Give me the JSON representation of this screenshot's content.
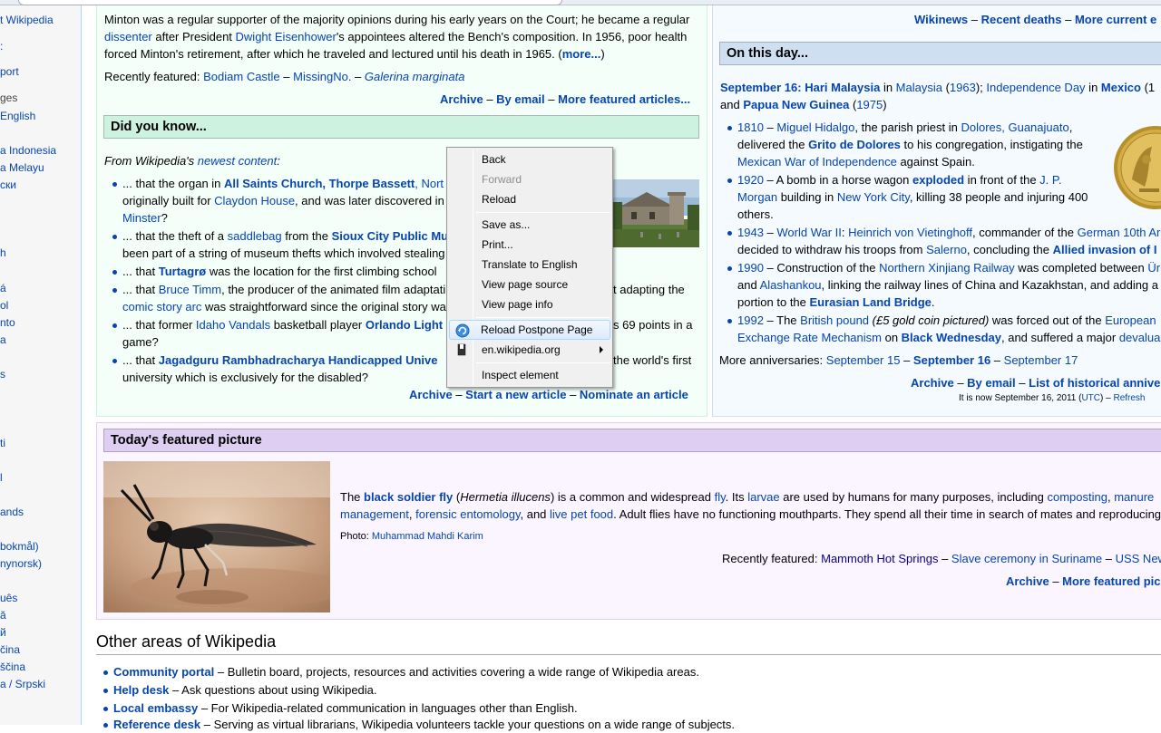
{
  "sidebar": {
    "items": [
      {
        "label": "t Wikipedia",
        "link": true
      },
      {
        "label": ":",
        "link": true
      },
      {
        "label": "port",
        "link": true
      },
      {
        "label": "ges",
        "link": false
      },
      {
        "label": " English",
        "link": true
      },
      {
        "label": "a Indonesia",
        "link": true
      },
      {
        "label": "a Melayu",
        "link": true
      },
      {
        "label": "ски",
        "link": true
      },
      {
        "label": "h",
        "link": true
      },
      {
        "label": "á",
        "link": true
      },
      {
        "label": "ol",
        "link": true
      },
      {
        "label": "nto",
        "link": true
      },
      {
        "label": "a",
        "link": true
      },
      {
        "label": "s",
        "link": true
      },
      {
        "label": "ti",
        "link": true
      },
      {
        "label": "l",
        "link": true
      },
      {
        "label": "ands",
        "link": true
      },
      {
        "label": "bokmål)",
        "link": true
      },
      {
        "label": "nynorsk)",
        "link": true
      },
      {
        "label": "uês",
        "link": true
      },
      {
        "label": "ă",
        "link": true
      },
      {
        "label": "й",
        "link": true
      },
      {
        "label": "čina",
        "link": true
      },
      {
        "label": "ščina",
        "link": true
      },
      {
        "label": "a / Srpski",
        "link": true
      }
    ]
  },
  "tfa": {
    "l1_a": "Minton was a regular supporter of the majority opinions during his early years on the Court; he became a regular",
    "l2_link1": "dissenter",
    "l2_a": " after President ",
    "l2_link2": "Dwight Eisenhower",
    "l2_b": "'s appointees altered the Bench's composition. In 1956, poor health",
    "l3_a": "forced Minton's retirement, after which he traveled and lectured until his death in 1965. (",
    "l3_more": "more...",
    "l3_b": ")",
    "recent_label": "Recently featured: ",
    "recent_1": "Bodiam Castle",
    "recent_sep1": " – ",
    "recent_2": "MissingNo.",
    "recent_sep2": " – ",
    "recent_3": "Galerina marginata",
    "archive": "Archive",
    "sep": " – ",
    "by_email": "By email",
    "more_articles": "More featured articles..."
  },
  "dyk": {
    "heading": "Did you know...",
    "intro_a": "From Wikipedia's ",
    "intro_link": "newest content",
    "intro_b": ":",
    "b1_a": "... that the organ in ",
    "b1_link": "All Saints Church, Thorpe Bassett",
    "b1_b": ", Nort",
    "b1_l2_a": "originally built for ",
    "b1_l2_link": "Claydon House",
    "b1_l2_b": ", and was later discovered in ",
    "b1_l3": "Minster",
    "b1_l3_b": "?",
    "b2_a": "... that the theft of a ",
    "b2_link1": "saddlebag",
    "b2_b": " from the ",
    "b2_link2": "Sioux City Public Mu",
    "b2_l2": "been part of a string of museum thefts which involved stealing",
    "b3_a": "... that ",
    "b3_link": "Turtagrø",
    "b3_b": " was the location for the first climbing school",
    "b4_a": "... that ",
    "b4_link": "Bruce Timm",
    "b4_b": ", the producer of the animated film adaptati",
    "b4_c": "t adapting the",
    "b4_l2_link": "comic story arc",
    "b4_l2": " was straightforward since the original story wa",
    "b5_a": "... that former ",
    "b5_link1": "Idaho Vandals",
    "b5_b": " basketball player ",
    "b5_link2": "Orlando Light",
    "b5_c": "s 69 points in a",
    "b5_l2": "game?",
    "b6_a": "... that ",
    "b6_link": "Jagadguru Rambhadracharya Handicapped Unive",
    "b6_b": " the world's first",
    "b6_l2": "university which is exclusively for the disabled?",
    "archive": "Archive",
    "sep": " – ",
    "start": "Start a new article",
    "nominate": "Nominate an article"
  },
  "news": {
    "top_1": "Wikinews",
    "top_sep1": " – ",
    "top_2": "Recent deaths",
    "top_sep2": " – ",
    "top_3": "More current e"
  },
  "otd": {
    "heading": "On this day...",
    "l1_date": "September 16",
    "l1_colon": ": ",
    "l1_link1": "Hari Malaysia",
    "l1_in": " in ",
    "l1_link2": "Malaysia",
    "l1_paren_o": " (",
    "l1_year": "1963",
    "l1_paren_c": "); ",
    "l1_link3": "Independence Day",
    "l1_in2": " in ",
    "l1_link4": "Mexico",
    "l1_tail": " (1",
    "l2_a": "and ",
    "l2_link": "Papua New Guinea",
    "l2_b": " (",
    "l2_year": "1975",
    "l2_c": ")",
    "e1_year": "1810",
    "e1_a": " – ",
    "e1_link1": "Miguel Hidalgo",
    "e1_b": ", the parish priest in ",
    "e1_link2": "Dolores, Guanajuato",
    "e1_c": ",",
    "e1_l2_a": "delivered the ",
    "e1_l2_link": "Grito de Dolores",
    "e1_l2_b": " to his congregation, instigating the",
    "e1_l3_link": "Mexican War of Independence",
    "e1_l3_b": " against Spain.",
    "e2_year": "1920",
    "e2_a": " – A bomb in a horse wagon ",
    "e2_link1": "exploded",
    "e2_b": " in front of the ",
    "e2_link2": "J. P.",
    "e2_l2_link": "Morgan",
    "e2_l2_a": " building in ",
    "e2_l2_link2": "New York City",
    "e2_l2_b": ", killing 38 people and injuring 400",
    "e2_l3": "others.",
    "e3_year": "1943",
    "e3_a": " – ",
    "e3_link1": "World War II",
    "e3_b": ": ",
    "e3_link2": "Heinrich von Vietinghoff",
    "e3_c": ", commander of the ",
    "e3_link3": "German 10th Ar",
    "e3_l2_a": "decided to withdraw his troops from ",
    "e3_l2_link": "Salerno",
    "e3_l2_b": ", concluding the ",
    "e3_l2_link2": "Allied invasion of I",
    "e4_year": "1990",
    "e4_a": " – Construction of the ",
    "e4_link": "Northern Xinjiang Railway",
    "e4_b": " was completed between ",
    "e4_link2": "Ürü",
    "e4_l2_a": "and ",
    "e4_l2_link": "Alashankou",
    "e4_l2_b": ", linking the railway lines of China and Kazakhstan, and adding a",
    "e4_l3_a": "portion to the ",
    "e4_l3_link": "Eurasian Land Bridge",
    "e4_l3_b": ".",
    "e5_year": "1992",
    "e5_a": " – The ",
    "e5_link": "British pound",
    "e5_b": " (£5 gold coin pictured)",
    "e5_c": " was forced out of the ",
    "e5_link2": "European",
    "e5_l2_link": "Exchange Rate Mechanism",
    "e5_l2_a": " on ",
    "e5_l2_link2": "Black Wednesday",
    "e5_l2_b": ", and suffered a major ",
    "e5_l2_link3": "devalua",
    "more_label": "More anniversaries: ",
    "more_1": "September 15",
    "more_sep1": " – ",
    "more_2": "September 16",
    "more_sep2": " – ",
    "more_3": "September 17",
    "archive": "Archive",
    "sep": " – ",
    "by_email": "By email",
    "list": "List of historical annive",
    "now_a": "It is now September 16, 2011 (",
    "now_utc": "UTC",
    "now_b": ") – ",
    "now_refresh": "Refresh"
  },
  "tfp": {
    "heading": "Today's featured picture",
    "l1_a": "The ",
    "l1_link1": "black soldier fly",
    "l1_b": " (",
    "l1_i": "Hermetia illucens",
    "l1_c": ") is a common and widespread ",
    "l1_link2": "fly",
    "l1_d": ". Its ",
    "l1_link3": "larvae",
    "l1_e": " are used by humans for many purposes, including ",
    "l1_link4": "composting",
    "l1_f": ", ",
    "l1_link5": "manure",
    "l2_link1": "management",
    "l2_a": ", ",
    "l2_link2": "forensic entomology",
    "l2_b": ", and ",
    "l2_link3": "live pet food",
    "l2_c": ". Adult flies have no functioning mouthparts. They spend all their time in search of mates and reproducing",
    "photo_label": "Photo: ",
    "photo_link": "Muhammad Mahdi Karim",
    "recent_label": "Recently featured: ",
    "recent_1": "Mammoth Hot Springs",
    "recent_sep1": " – ",
    "recent_2": "Slave ceremony in Suriname",
    "recent_sep2": " – ",
    "recent_3": "USS New",
    "archive": "Archive",
    "sep": " – ",
    "more": "More featured pic"
  },
  "other": {
    "heading": "Other areas of Wikipedia",
    "i1_link": "Community portal",
    "i1_text": " – Bulletin board, projects, resources and activities covering a wide range of Wikipedia areas.",
    "i2_link": "Help desk",
    "i2_text": " – Ask questions about using Wikipedia.",
    "i3_link": "Local embassy",
    "i3_text": " – For Wikipedia-related communication in languages other than English.",
    "i4_link": "Reference desk",
    "i4_text": " – Serving as virtual librarians, Wikipedia volunteers tackle your questions on a wide range of subjects."
  },
  "context_menu": {
    "back": "Back",
    "forward": "Forward",
    "reload": "Reload",
    "save_as": "Save as...",
    "print": "Print...",
    "translate": "Translate to English",
    "view_source": "View page source",
    "view_info": "View page info",
    "reload_postpone": "Reload Postpone Page",
    "site": "en.wikipedia.org",
    "inspect": "Inspect element"
  },
  "colors": {
    "link": "#0645ad",
    "dyk_header": "#cef2e0",
    "otd_header": "#cedff2",
    "tfp_header": "#ddcef2",
    "menu_highlight": "#dcebfc"
  }
}
